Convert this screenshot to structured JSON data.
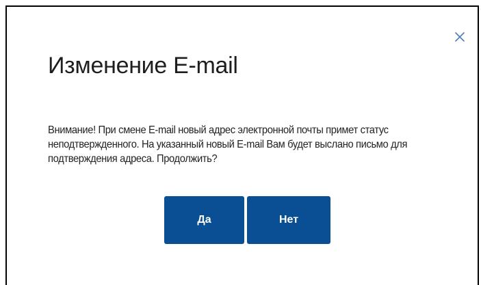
{
  "dialog": {
    "title": "Изменение E-mail",
    "message": "Внимание! При смене E-mail новый адрес электронной почты примет статус неподтвержденного. На указанный новый E-mail Вам будет выслано письмо для подтверждения адреса. Продолжить?",
    "yes_label": "Да",
    "no_label": "Нет",
    "close_icon": "close-icon"
  },
  "colors": {
    "button_bg": "#0a4f93",
    "close_icon": "#4a7fb8",
    "title_text": "#1e1e1e"
  }
}
